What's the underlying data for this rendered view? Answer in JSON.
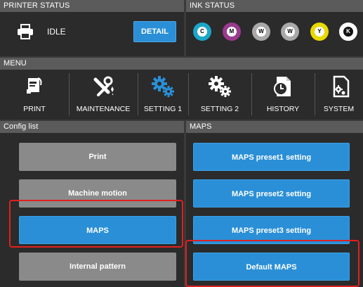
{
  "printer_status": {
    "header": "PRINTER STATUS",
    "state": "IDLE",
    "detail_label": "DETAIL"
  },
  "ink_status": {
    "header": "INK STATUS",
    "inks": [
      {
        "letter": "C",
        "color": "#1aa7c9"
      },
      {
        "letter": "M",
        "color": "#9b3a8e"
      },
      {
        "letter": "W",
        "color": "#a9a9a9"
      },
      {
        "letter": "W",
        "color": "#a9a9a9"
      },
      {
        "letter": "Y",
        "color": "#e8d800"
      },
      {
        "letter": "K",
        "color": "#111111"
      }
    ]
  },
  "menu": {
    "header": "MENU",
    "items": [
      {
        "label": "PRINT",
        "icon": "print-icon"
      },
      {
        "label": "MAINTENANCE",
        "icon": "maintenance-icon"
      },
      {
        "label": "SETTING 1",
        "icon": "setting1-gears-icon",
        "active": true
      },
      {
        "label": "SETTING 2",
        "icon": "setting2-gears-icon"
      },
      {
        "label": "HISTORY",
        "icon": "history-icon"
      },
      {
        "label": "SYSTEM",
        "icon": "system-icon"
      }
    ],
    "active_color": "#2a8fd6"
  },
  "config_list": {
    "header": "Config list",
    "items": [
      {
        "label": "Print",
        "style": "gray"
      },
      {
        "label": "Machine motion",
        "style": "gray"
      },
      {
        "label": "MAPS",
        "style": "blue",
        "selected": true
      },
      {
        "label": "Internal pattern",
        "style": "gray"
      }
    ]
  },
  "maps": {
    "header": "MAPS",
    "items": [
      {
        "label": "MAPS preset1 setting"
      },
      {
        "label": "MAPS preset2 setting"
      },
      {
        "label": "MAPS preset3 setting"
      },
      {
        "label": "Default MAPS",
        "highlighted": true
      }
    ]
  },
  "colors": {
    "accent": "#2a8fd6",
    "highlight": "#e02020",
    "panel": "#2b2b2b",
    "header": "#5b5b5b"
  }
}
